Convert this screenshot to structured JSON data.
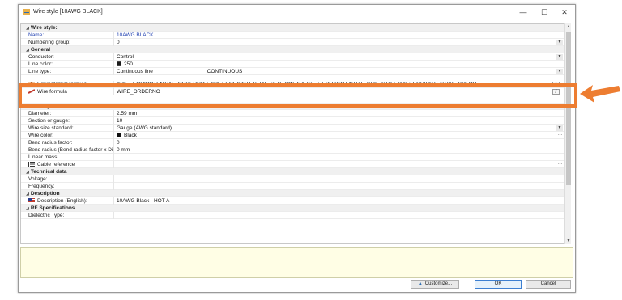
{
  "window": {
    "title": "Wire style [10AWG BLACK]",
    "minimize": "—",
    "maximize": "☐",
    "close": "✕"
  },
  "groups": {
    "wire_style": "Wire style",
    "general": "General",
    "cabling": "Cabling",
    "technical": "Technical data",
    "description": "Description",
    "rf": "RF Specifications"
  },
  "wire_style": {
    "name_label": "Name:",
    "name_value": "10AWG BLACK",
    "numbering_label": "Numbering group:",
    "numbering_value": "0"
  },
  "general": {
    "conductor_label": "Conductor:",
    "conductor_value": "Control",
    "line_color_label": "Line color:",
    "line_color_value": "250",
    "line_color_hex": "#1a1a1a",
    "line_type_label": "Line type:",
    "line_type_value": "Continuous line__________________ CONTINUOUS",
    "equipotential_label": "Equipotential formula",
    "equipotential_value": "(\"#\") + EQUIPOTENTIAL_ORDERNO + (\" \") + EQUIPOTENTIAL_SECTION_GAUGE + EQUIPOTENTIAL_SIZE_STD + (\" \") + EQUIPOTENTIAL_COLOR",
    "wire_formula_label": "Wire formula",
    "wire_formula_value": "WIRE_ORDERNO"
  },
  "cabling": {
    "diameter_label": "Diameter:",
    "diameter_value": "2.59 mm",
    "section_label": "Section or gauge:",
    "section_value": "10",
    "size_std_label": "Wire size standard:",
    "size_std_value": "Gauge (AWG standard)",
    "wire_color_label": "Wire color:",
    "wire_color_value": "Black",
    "bend_factor_label": "Bend radius factor:",
    "bend_factor_value": "0",
    "bend_radius_label": "Bend radius (Bend radius factor x Dia",
    "bend_radius_value": "0 mm",
    "linear_mass_label": "Linear mass:",
    "cable_ref_label": "Cable reference"
  },
  "technical": {
    "voltage_label": "Voltage:",
    "frequency_label": "Frequency:"
  },
  "description": {
    "english_label": "Description (English):",
    "english_value": "10AWG Black - HOT A"
  },
  "rf": {
    "dielectric_label": "Dielectric Type:"
  },
  "buttons": {
    "customize": "Customize...",
    "ok": "OK",
    "cancel": "Cancel"
  },
  "colors": {
    "highlight": "#ed7d31",
    "name_blue": "#1f3fb0",
    "description_bg": "#fffee5"
  },
  "icons": {
    "equipotential": "formula-icon",
    "wire": "wire-icon",
    "cable": "cable-reference-icon",
    "flag": "us-flag-icon"
  }
}
